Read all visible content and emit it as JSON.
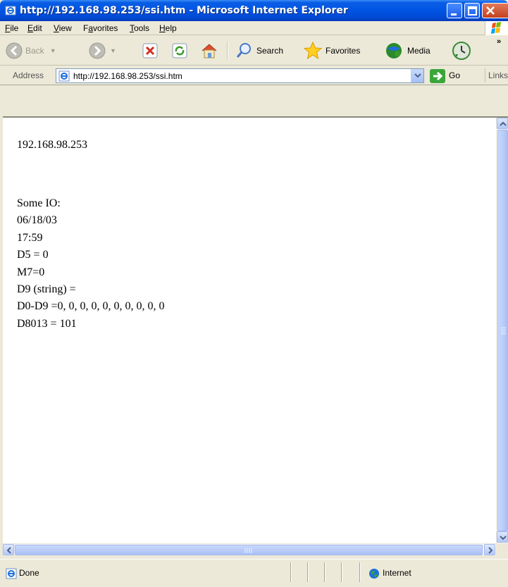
{
  "window": {
    "title": "http://192.168.98.253/ssi.htm - Microsoft Internet Explorer"
  },
  "menu": {
    "items": [
      {
        "label": "File",
        "accel": "F"
      },
      {
        "label": "Edit",
        "accel": "E"
      },
      {
        "label": "View",
        "accel": "V"
      },
      {
        "label": "Favorites",
        "accel": "a"
      },
      {
        "label": "Tools",
        "accel": "T"
      },
      {
        "label": "Help",
        "accel": "H"
      }
    ]
  },
  "toolbar": {
    "back_label": "Back",
    "search_label": "Search",
    "favorites_label": "Favorites",
    "media_label": "Media",
    "more": "»"
  },
  "address": {
    "label": "Address",
    "url": "http://192.168.98.253/ssi.htm",
    "go_label": "Go",
    "links_label": "Links"
  },
  "page": {
    "ip": "192.168.98.253",
    "io_lines": [
      "Some IO:",
      "06/18/03",
      "17:59",
      "D5 = 0",
      "M7=0",
      "D9 (string) =",
      "D0-D9 =0, 0, 0, 0, 0, 0, 0, 0, 0, 0",
      "D8013 = 101"
    ]
  },
  "status": {
    "text": "Done",
    "zone": "Internet"
  },
  "colors": {
    "titlebar": "#0054e3",
    "background": "#ece9d8"
  }
}
